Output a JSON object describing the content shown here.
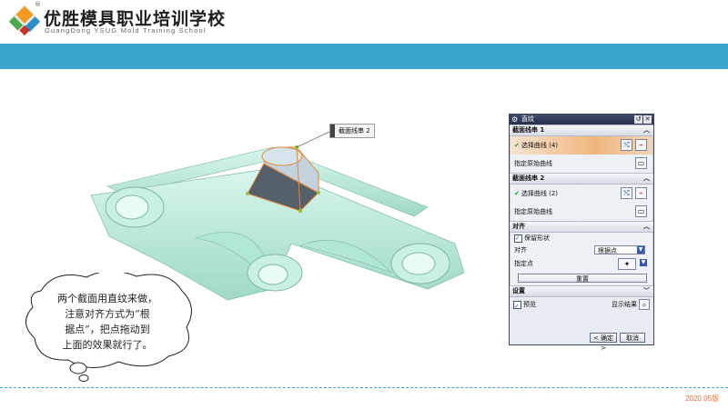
{
  "header": {
    "brand_cn": "优胜模具职业培训学校",
    "brand_en": "GuangDong YSUG Mold Training School",
    "registered": "®"
  },
  "viewport": {
    "section_label": "截面线串 2"
  },
  "note": {
    "lines": [
      "两个截面用直纹来做，",
      "注意对齐方式为“根",
      "据点”，把点拖动到",
      "上面的效果就行了。"
    ]
  },
  "dialog": {
    "title": "直纹",
    "section1": {
      "header": "截面线串 1",
      "select_curve": "选择曲线 (4)",
      "origin_curve": "指定原始曲线"
    },
    "section2": {
      "header": "截面线串 2",
      "select_curve": "选择曲线 (2)",
      "origin_curve": "指定原始曲线"
    },
    "align": {
      "header": "对齐",
      "keep_shape": "保留形状",
      "align_label": "对齐",
      "align_value": "根据点",
      "specify_point": "指定点",
      "reset": "重置"
    },
    "settings": {
      "header": "设置"
    },
    "preview": "预览",
    "show_result": "显示结果",
    "ok": "< 确定 >",
    "cancel": "取消"
  },
  "footer": {
    "version": "2020.05版"
  },
  "colors": {
    "band": "#3aa6cc",
    "model": "#bfeee0",
    "accent_orange": "#f0a060",
    "version_text": "#e06d3a"
  }
}
